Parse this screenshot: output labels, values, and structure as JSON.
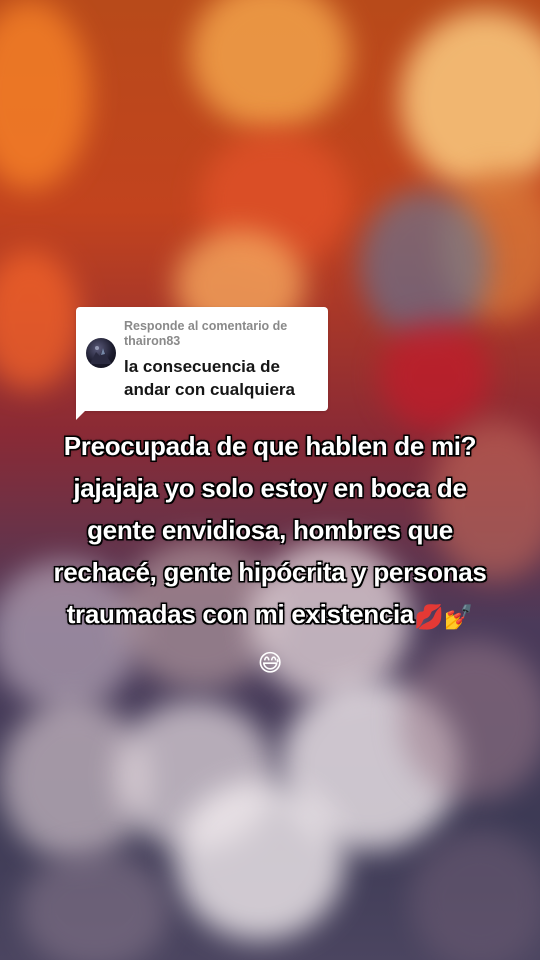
{
  "reply": {
    "header": "Responde al comentario de thairon83",
    "comment": "la consecuencia de andar con cualquiera",
    "avatar_icon": "user-avatar-icon"
  },
  "caption": {
    "line1": "Preocupada de que hablen de mi?",
    "line2": "jajajaja yo solo estoy en boca de",
    "line3": "gente envidiosa, hombres que",
    "line4": "rechacé, gente hipócrita y personas",
    "line5": "traumadas con mi existencia",
    "emoji_lips": "💋",
    "emoji_nails": "💅",
    "emoji_face": "😅"
  },
  "colors": {
    "caption_text": "#ffffff",
    "caption_outline": "#000000",
    "bubble_bg": "#ffffff",
    "bubble_header": "#8a8a8a"
  }
}
